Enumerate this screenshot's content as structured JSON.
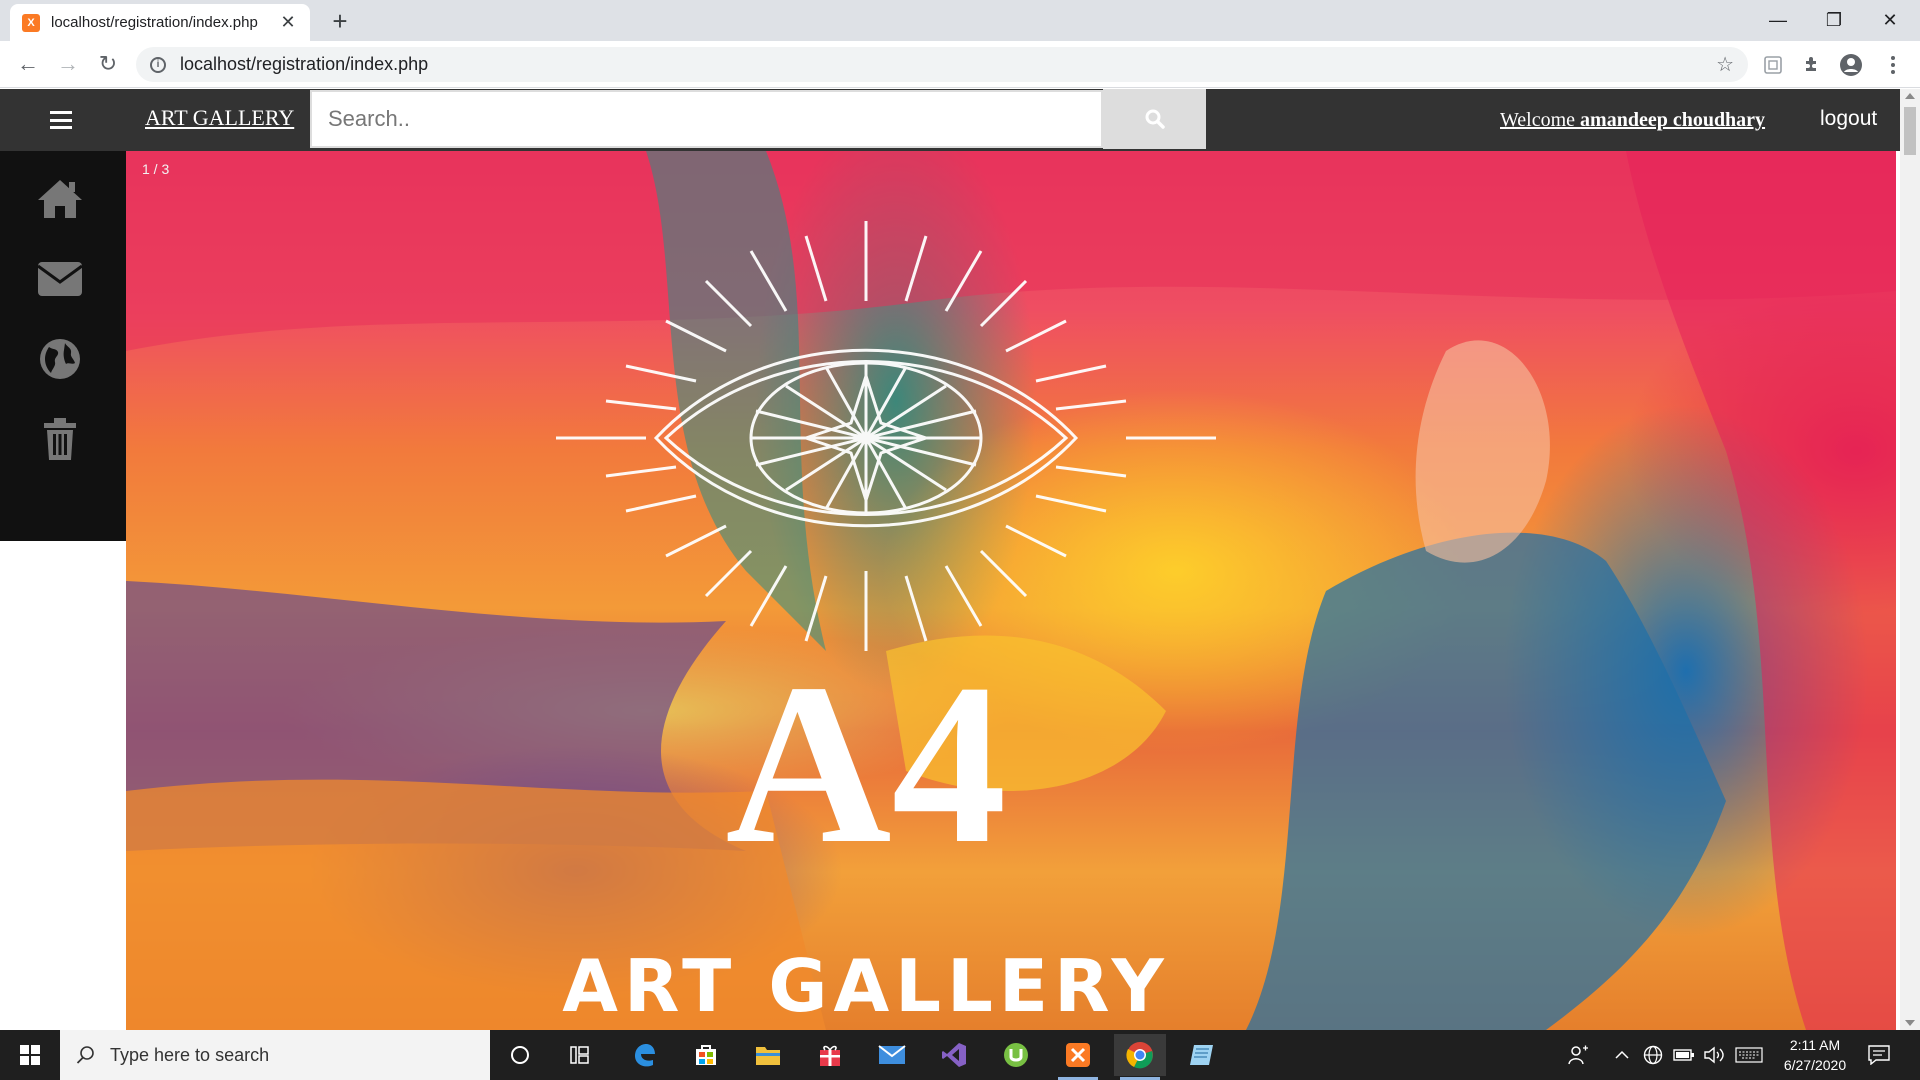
{
  "browser": {
    "tab_title": "localhost/registration/index.php",
    "url": "localhost/registration/index.php",
    "favicon_label": "XAMPP"
  },
  "site": {
    "brand": "ART GALLERY",
    "search_placeholder": "Search..",
    "welcome_prefix": "Welcome ",
    "username": "amandeep choudhary",
    "logout": "logout",
    "sidebar": [
      "home-icon",
      "envelope-icon",
      "globe-icon",
      "trash-icon"
    ]
  },
  "slideshow": {
    "counter": "1 / 3",
    "logo_big": "A4",
    "logo_text": "ART GALLERY"
  },
  "taskbar": {
    "search_placeholder": "Type here to search",
    "time": "2:11 AM",
    "date": "6/27/2020"
  },
  "colors": {
    "navbar": "#333333",
    "sidebar": "#111111",
    "search_button": "#dddddd",
    "accent_xampp": "#fb7a24"
  }
}
